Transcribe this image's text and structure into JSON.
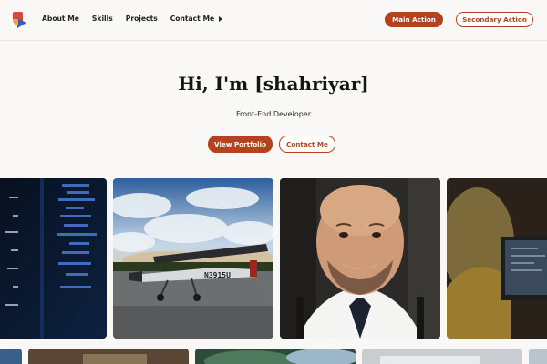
{
  "nav": {
    "logo_icon": "logo-icon",
    "items": [
      "About Me",
      "Skills",
      "Projects",
      "Contact Me"
    ],
    "main_action": "Main Action",
    "secondary_action": "Secondary Action"
  },
  "hero": {
    "title": "Hi, I'm [shahriyar]",
    "subtitle": "Front-End Developer",
    "primary_cta": "View Portfolio",
    "secondary_cta": "Contact Me"
  },
  "colors": {
    "accent": "#b5421f",
    "background": "#faf8f6"
  }
}
